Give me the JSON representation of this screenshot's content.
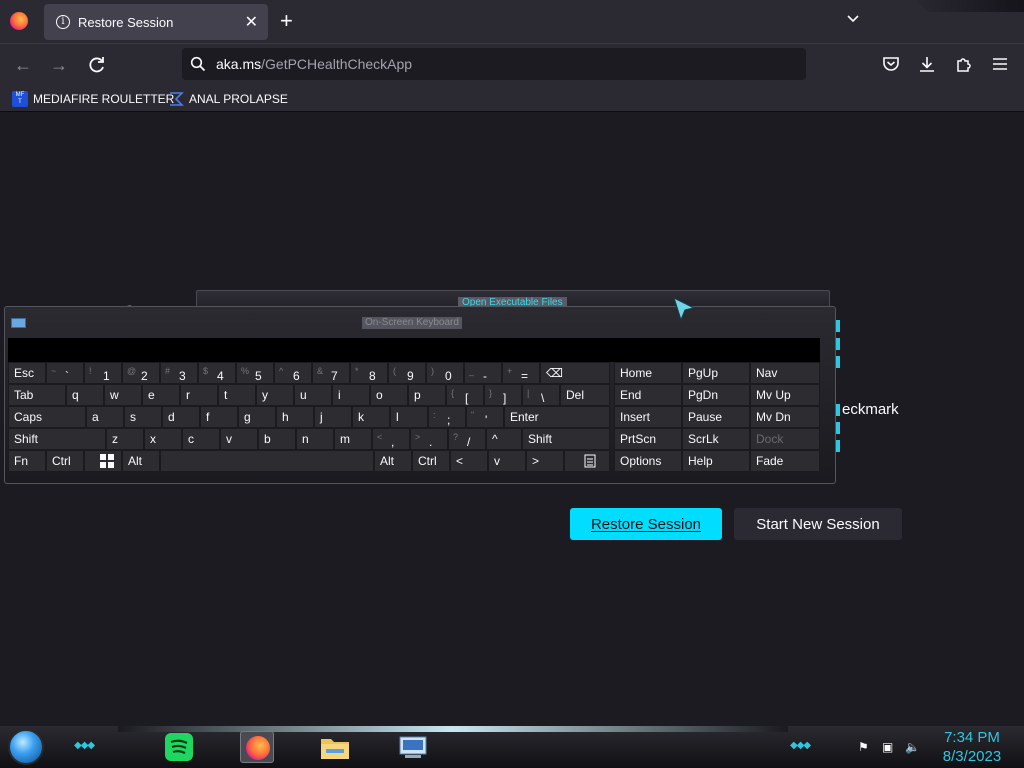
{
  "browser": {
    "tab_title": "Restore Session",
    "url_host": "aka.ms",
    "url_path": "/GetPCHealthCheckApp",
    "bookmarks": [
      {
        "label": "MEDIAFIRE ROULETTER",
        "icon": "mediafire-icon"
      },
      {
        "label": "ANAL PROLAPSE",
        "icon": "sigma-icon"
      }
    ]
  },
  "page": {
    "restore_button": "Restore Session",
    "new_session_button": "Start New Session",
    "peek_text": "eckmark"
  },
  "background_window": {
    "title": "Open Executable Files"
  },
  "keyboard": {
    "title": "On-Screen Keyboard",
    "rows": [
      [
        {
          "label": "Esc"
        },
        {
          "sub": "~",
          "label": "`"
        },
        {
          "sub": "!",
          "label": "1"
        },
        {
          "sub": "@",
          "label": "2"
        },
        {
          "sub": "#",
          "label": "3"
        },
        {
          "sub": "$",
          "label": "4"
        },
        {
          "sub": "%",
          "label": "5"
        },
        {
          "sub": "^",
          "label": "6"
        },
        {
          "sub": "&",
          "label": "7"
        },
        {
          "sub": "*",
          "label": "8"
        },
        {
          "sub": "(",
          "label": "9"
        },
        {
          "sub": ")",
          "label": "0"
        },
        {
          "sub": "_",
          "label": "-"
        },
        {
          "sub": "+",
          "label": "="
        },
        {
          "label": "⌫"
        }
      ],
      [
        {
          "label": "Tab"
        },
        {
          "label": "q"
        },
        {
          "label": "w"
        },
        {
          "label": "e"
        },
        {
          "label": "r"
        },
        {
          "label": "t"
        },
        {
          "label": "y"
        },
        {
          "label": "u"
        },
        {
          "label": "i"
        },
        {
          "label": "o"
        },
        {
          "label": "p"
        },
        {
          "sub": "{",
          "label": "["
        },
        {
          "sub": "}",
          "label": "]"
        },
        {
          "sub": "|",
          "label": "\\"
        },
        {
          "label": "Del"
        }
      ],
      [
        {
          "label": "Caps"
        },
        {
          "label": "a"
        },
        {
          "label": "s"
        },
        {
          "label": "d"
        },
        {
          "label": "f"
        },
        {
          "label": "g"
        },
        {
          "label": "h"
        },
        {
          "label": "j"
        },
        {
          "label": "k"
        },
        {
          "label": "l"
        },
        {
          "sub": ":",
          "label": ";"
        },
        {
          "sub": "\"",
          "label": "'"
        },
        {
          "label": "Enter"
        }
      ],
      [
        {
          "label": "Shift"
        },
        {
          "label": "z"
        },
        {
          "label": "x"
        },
        {
          "label": "c"
        },
        {
          "label": "v"
        },
        {
          "label": "b"
        },
        {
          "label": "n"
        },
        {
          "label": "m"
        },
        {
          "sub": "<",
          "label": ","
        },
        {
          "sub": ">",
          "label": "."
        },
        {
          "sub": "?",
          "label": "/"
        },
        {
          "label": "^"
        },
        {
          "label": "Shift"
        }
      ],
      [
        {
          "label": "Fn"
        },
        {
          "label": "Ctrl"
        },
        {
          "label": ""
        },
        {
          "label": "Alt"
        },
        {
          "label": ""
        },
        {
          "label": "Alt"
        },
        {
          "label": "Ctrl"
        },
        {
          "label": "<"
        },
        {
          "label": "v"
        },
        {
          "label": ">"
        },
        {
          "label": ""
        }
      ]
    ],
    "side_keys": [
      [
        "Home",
        "PgUp",
        "Nav"
      ],
      [
        "End",
        "PgDn",
        "Mv Up"
      ],
      [
        "Insert",
        "Pause",
        "Mv Dn"
      ],
      [
        "PrtScn",
        "ScrLk",
        "Dock"
      ],
      [
        "Options",
        "Help",
        "Fade"
      ]
    ]
  },
  "taskbar": {
    "time": "7:34 PM",
    "date": "8/3/2023",
    "apps": [
      "spotify-icon",
      "firefox-icon",
      "file-explorer-icon",
      "on-screen-keyboard-icon"
    ]
  },
  "colors": {
    "accent": "#00ddff",
    "chrome": "#2b2a33",
    "page_bg": "#1c1b22",
    "clock": "#2fc6e0"
  }
}
